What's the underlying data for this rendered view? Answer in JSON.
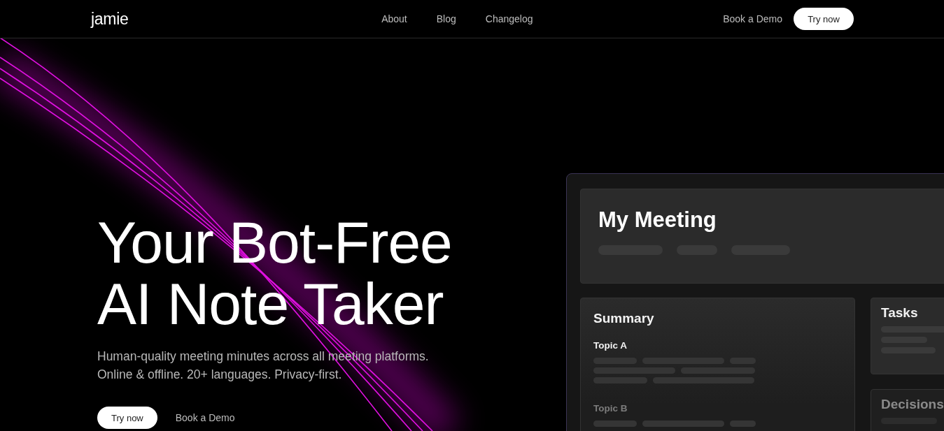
{
  "nav": {
    "logo": "jamie",
    "links": [
      "About",
      "Blog",
      "Changelog"
    ],
    "demo": "Book a Demo",
    "cta": "Try now"
  },
  "hero": {
    "title": "Your Bot-Free AI Note Taker",
    "subtitle": [
      "Human-quality meeting minutes across all meeting platforms.",
      "Online & offline. 20+ languages. Privacy-first."
    ],
    "cta": "Try now",
    "demo": "Book a Demo"
  },
  "mockup": {
    "title": "My Meeting",
    "summary": {
      "title": "Summary",
      "topics": [
        {
          "title": "Topic A",
          "dimmed": false
        },
        {
          "title": "Topic B",
          "dimmed": true
        }
      ]
    },
    "side_cards": [
      {
        "title": "Tasks",
        "dimmed": false
      },
      {
        "title": "Decisions",
        "dimmed": true
      }
    ]
  }
}
